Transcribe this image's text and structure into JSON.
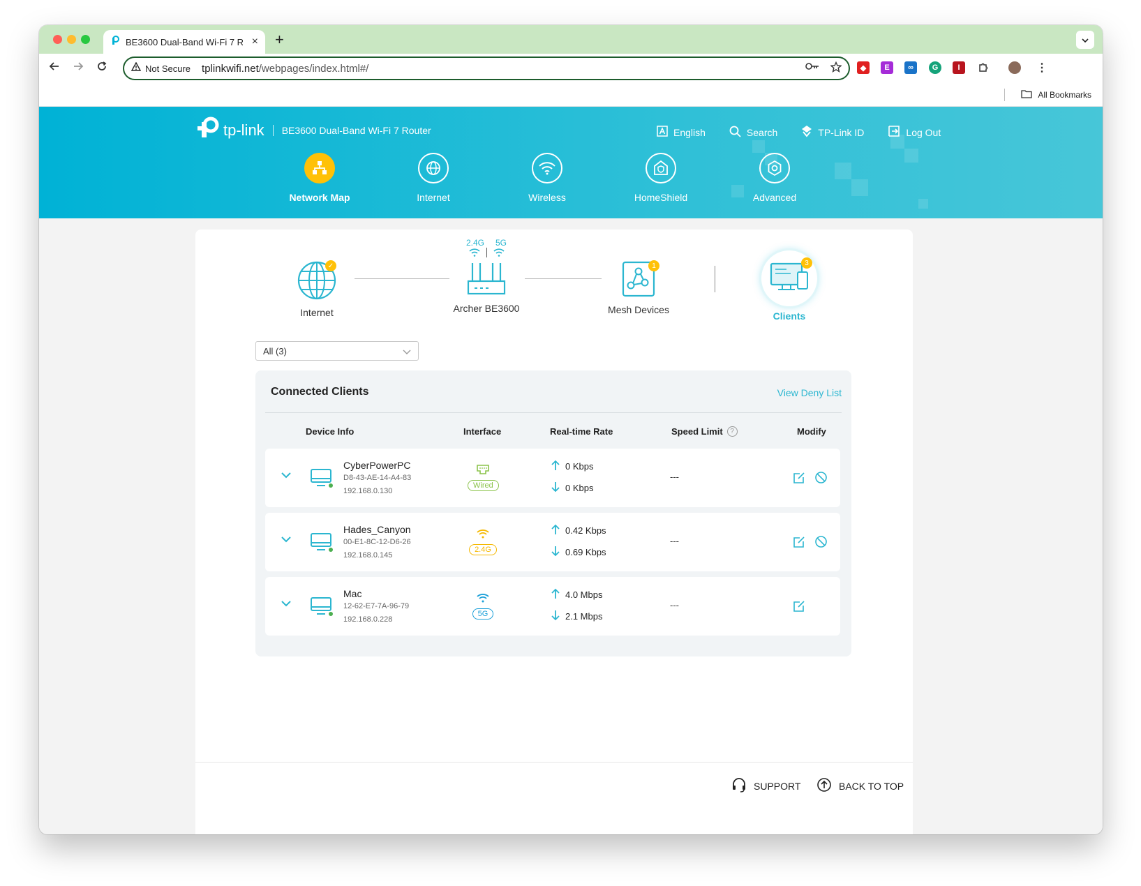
{
  "browser": {
    "tab_title": "BE3600 Dual-Band Wi-Fi 7 R…",
    "new_tab_label": "+",
    "security_label": "Not Secure",
    "url_host": "tplinkwifi.net",
    "url_path": "/webpages/index.html#/",
    "bookmarks_label": "All Bookmarks"
  },
  "header": {
    "brand": "tp-link",
    "model": "BE3600 Dual-Band Wi-Fi 7 Router",
    "links": {
      "language": "English",
      "search": "Search",
      "tplink_id": "TP-Link ID",
      "logout": "Log Out"
    },
    "nav": [
      {
        "label": "Network Map",
        "icon": "network-map-icon",
        "active": true
      },
      {
        "label": "Internet",
        "icon": "globe-icon",
        "active": false
      },
      {
        "label": "Wireless",
        "icon": "wifi-icon",
        "active": false
      },
      {
        "label": "HomeShield",
        "icon": "homeshield-icon",
        "active": false
      },
      {
        "label": "Advanced",
        "icon": "gear-icon",
        "active": false
      }
    ]
  },
  "topology": {
    "internet_label": "Internet",
    "router_label": "Archer BE3600",
    "band_24": "2.4G",
    "band_5": "5G",
    "mesh_label": "Mesh Devices",
    "mesh_count": "1",
    "clients_label": "Clients",
    "clients_count": "3"
  },
  "filter": {
    "selected": "All (3)"
  },
  "clients_panel": {
    "title": "Connected Clients",
    "deny_link": "View Deny List",
    "columns": {
      "device": "Device Info",
      "interface": "Interface",
      "rate": "Real-time Rate",
      "speed_limit": "Speed Limit",
      "modify": "Modify"
    },
    "rows": [
      {
        "name": "CyberPowerPC",
        "mac": "D8-43-AE-14-A4-83",
        "ip": "192.168.0.130",
        "interface": "Wired",
        "up": "0 Kbps",
        "down": "0 Kbps",
        "speed_limit": "---",
        "blockable": true
      },
      {
        "name": "Hades_Canyon",
        "mac": "00-E1-8C-12-D6-26",
        "ip": "192.168.0.145",
        "interface": "2.4G",
        "up": "0.42 Kbps",
        "down": "0.69 Kbps",
        "speed_limit": "---",
        "blockable": true
      },
      {
        "name": "Mac",
        "mac": "12-62-E7-7A-96-79",
        "ip": "192.168.0.228",
        "interface": "5G",
        "up": "4.0 Mbps",
        "down": "2.1 Mbps",
        "speed_limit": "---",
        "blockable": false
      }
    ]
  },
  "footer": {
    "support": "SUPPORT",
    "back_to_top": "BACK TO TOP"
  },
  "colors": {
    "brand": "#00b2d6",
    "active_nav": "#ffc107",
    "wired": "#8bc34a",
    "band_24": "#f5b800",
    "band_5": "#1a9fd8"
  }
}
